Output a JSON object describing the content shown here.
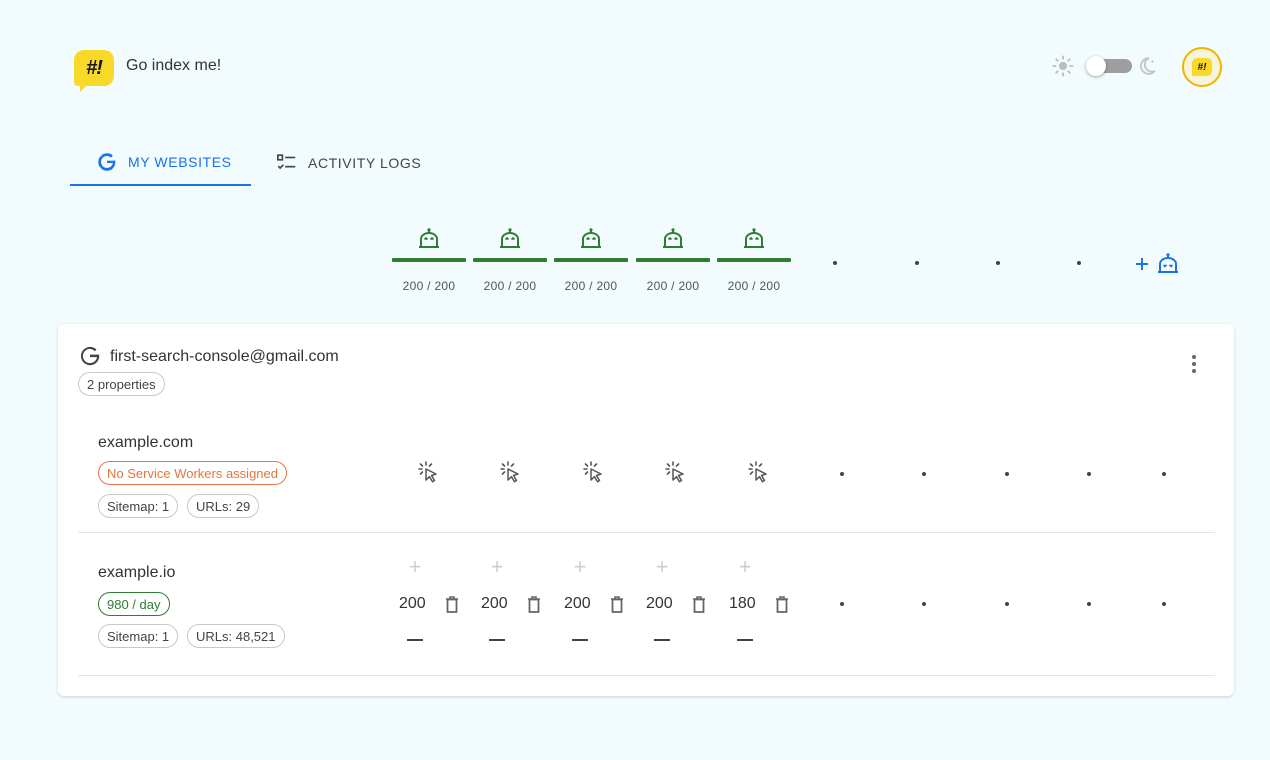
{
  "app": {
    "title": "Go index me!",
    "logo_text": "#!"
  },
  "theme": {
    "light_icon": "sun-icon",
    "dark_icon": "moon-icon",
    "dark_mode": false
  },
  "tabs": [
    {
      "label": "MY WEBSITES",
      "icon": "google-icon",
      "active": true
    },
    {
      "label": "ACTIVITY LOGS",
      "icon": "checklist-icon",
      "active": false
    }
  ],
  "service_workers": {
    "quotas": [
      "200 / 200",
      "200 / 200",
      "200 / 200",
      "200 / 200",
      "200 / 200"
    ],
    "empty_slots": 4,
    "add_icon": "add-robot-icon",
    "colors": {
      "active": "#2e7d32",
      "accent": "#1a73e8"
    }
  },
  "account": {
    "email": "first-search-console@gmail.com",
    "properties_label": "2 properties",
    "menu_icon": "more-vert-icon"
  },
  "sites": [
    {
      "name": "example.com",
      "status": "No Service Workers assigned",
      "sitemap": "Sitemap: 1",
      "urls": "URLs: 29"
    },
    {
      "name": "example.io",
      "status": "980 / day",
      "sitemap": "Sitemap: 1",
      "urls": "URLs: 48,521",
      "quotas": [
        "200",
        "200",
        "200",
        "200",
        "180"
      ]
    }
  ]
}
